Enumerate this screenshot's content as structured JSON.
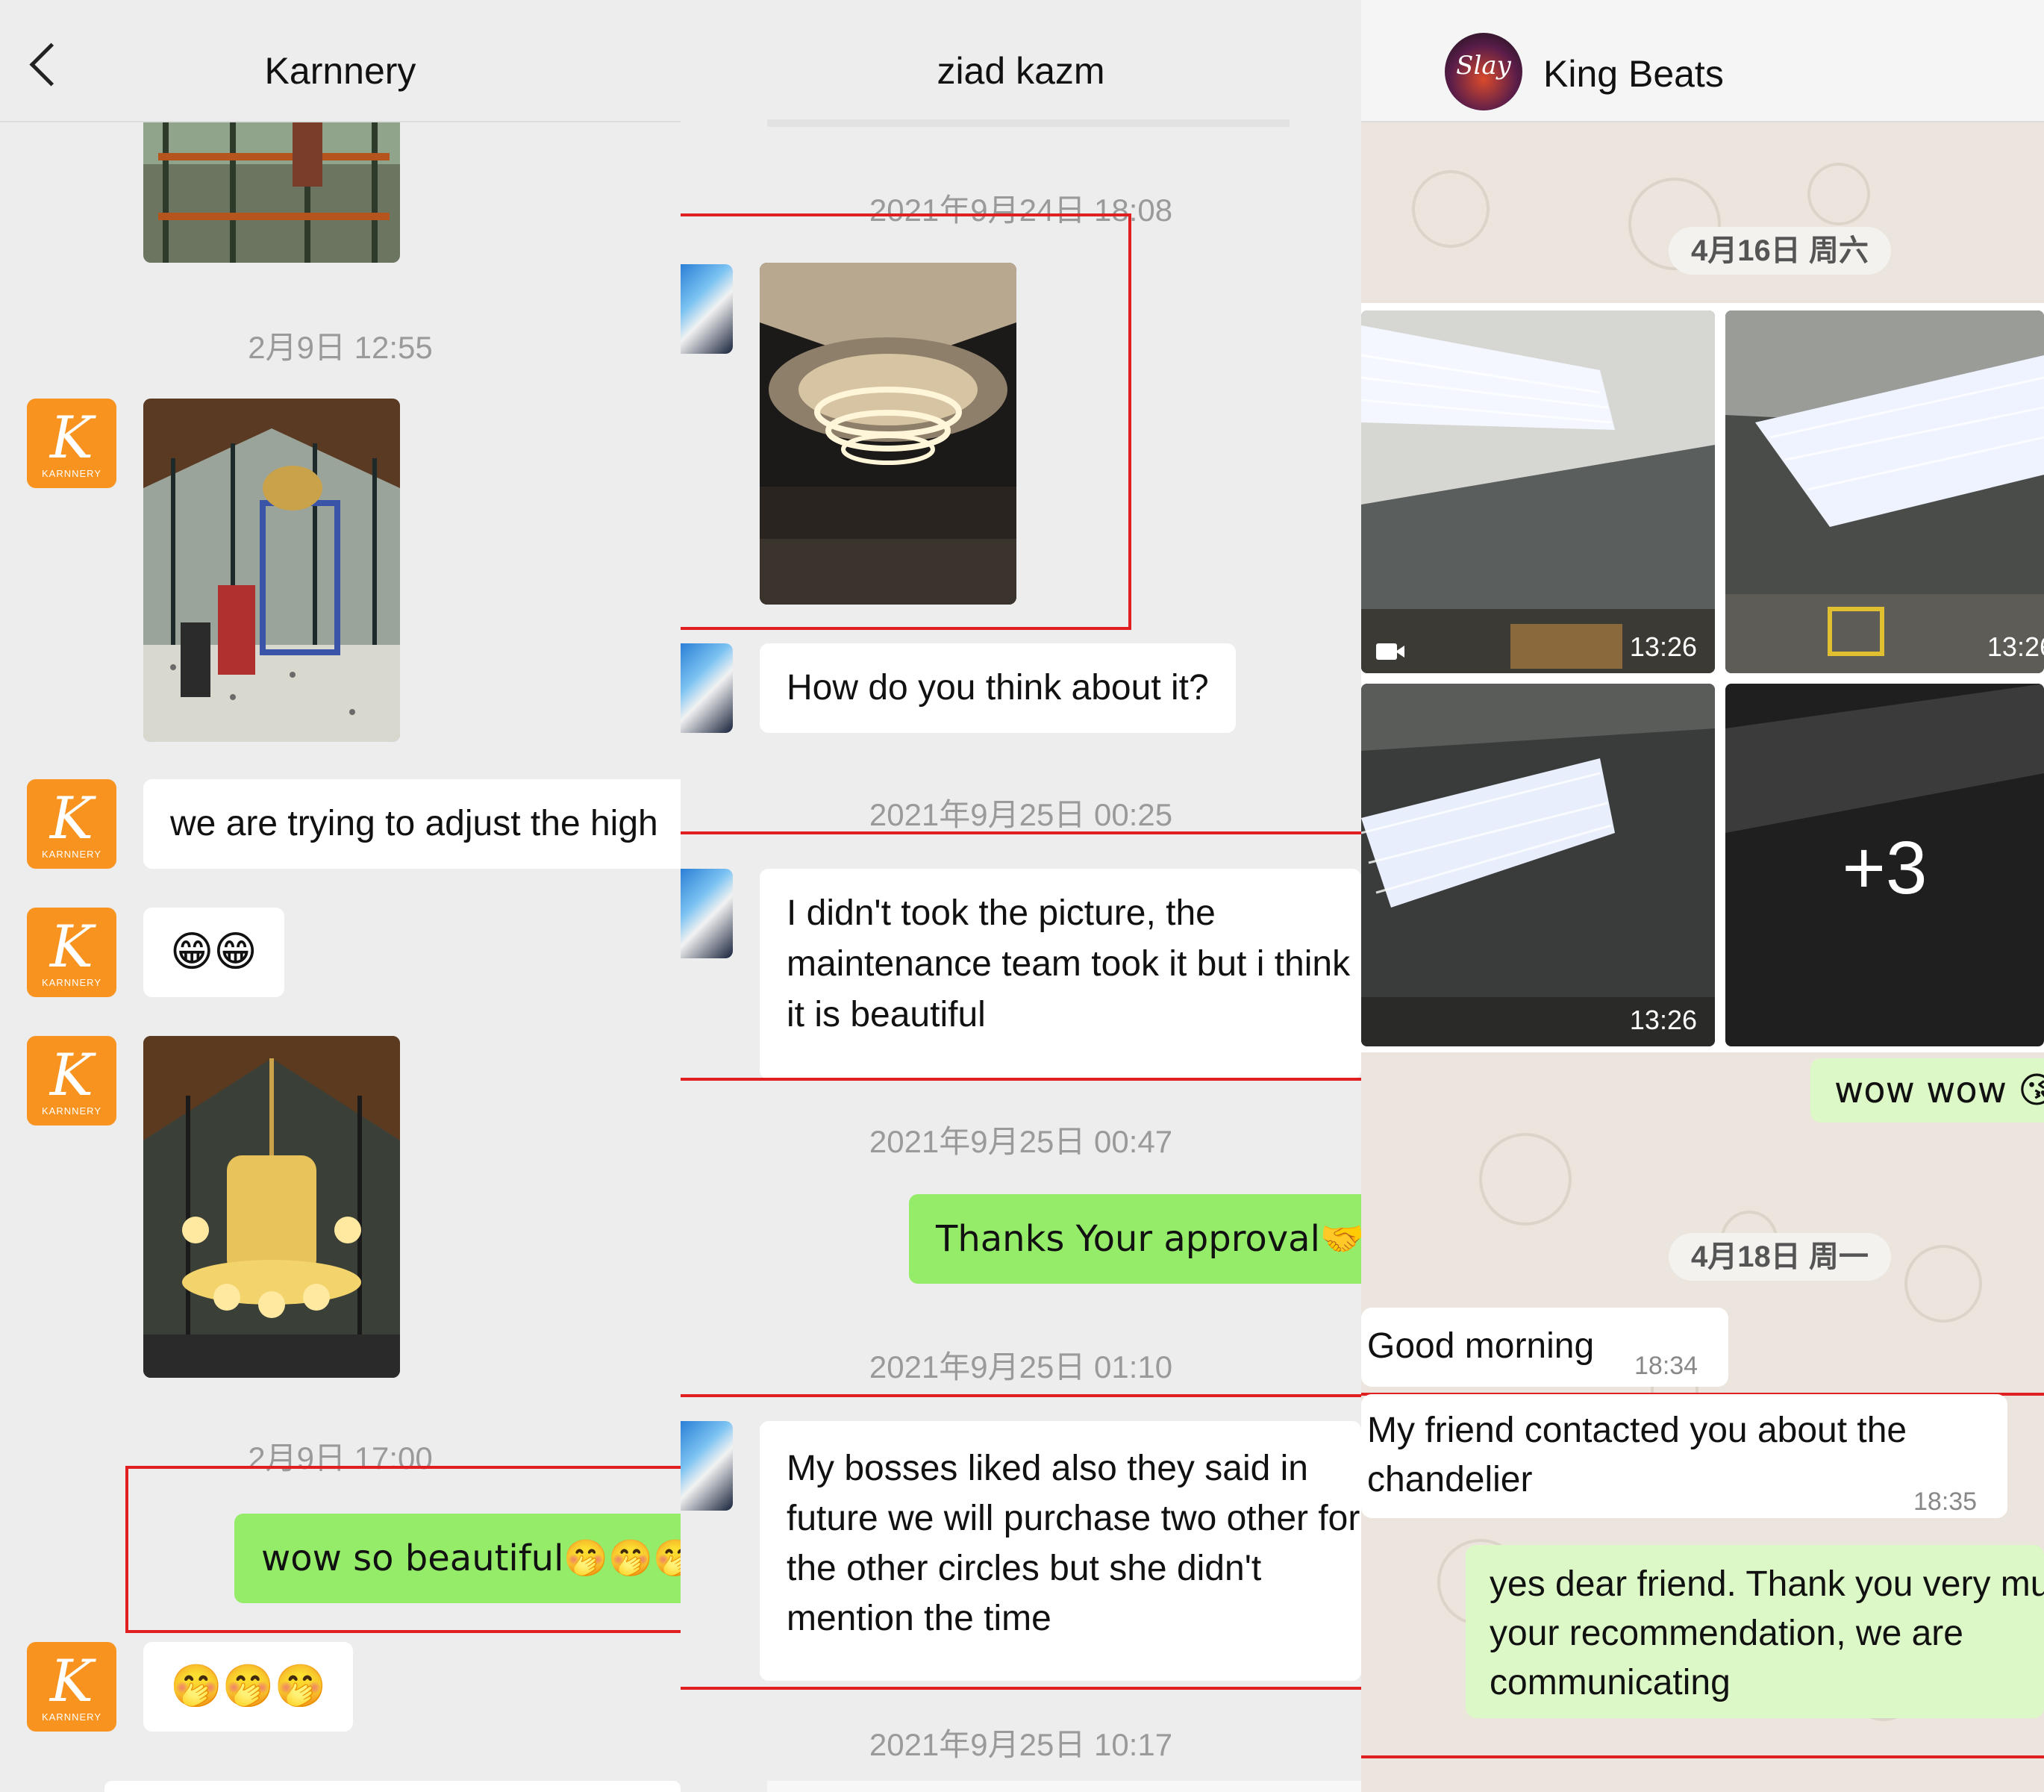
{
  "panel1": {
    "title": "Karnnery",
    "avatar_letter": "K",
    "avatar_brand": "KARNNERY",
    "timestamps": [
      "2月9日 12:55",
      "2月9日 17:00"
    ],
    "messages": {
      "text1": "we are trying to adjust the high",
      "emoji1": "😁😁",
      "green1": "wow so beautiful🤭🤭🤭",
      "emoji2": "🤭🤭🤭"
    }
  },
  "panel2": {
    "title": "ziad kazm",
    "timestamps": [
      "2021年9月24日 18:08",
      "2021年9月25日 00:25",
      "2021年9月25日 00:47",
      "2021年9月25日 01:10",
      "2021年9月25日 10:17"
    ],
    "messages": {
      "q1": "How do you think about it?",
      "m2": "I didn't took the picture, the maintenance team took it but i think it is beautiful",
      "green": "Thanks Your approval🤝🤝",
      "m4": "My bosses liked also they said in future we will purchase two other for the other circles but she didn't mention the time"
    }
  },
  "panel3": {
    "title": "King Beats",
    "avatar_text": "Slay",
    "dates": [
      "4月16日 周六",
      "4月18日 周一"
    ],
    "tiles": [
      {
        "time": "13:26"
      },
      {
        "time": "13:26"
      },
      {
        "time": "13:26"
      },
      {
        "overlay": "+3"
      }
    ],
    "messages": {
      "out1": "wow wow 😘",
      "in1": "Good morning",
      "in1_time": "18:34",
      "in2": "My friend contacted you about the chandelier",
      "in2_time": "18:35",
      "out2": "yes dear friend. Thank you very much for your recommendation, we are communicating"
    }
  }
}
